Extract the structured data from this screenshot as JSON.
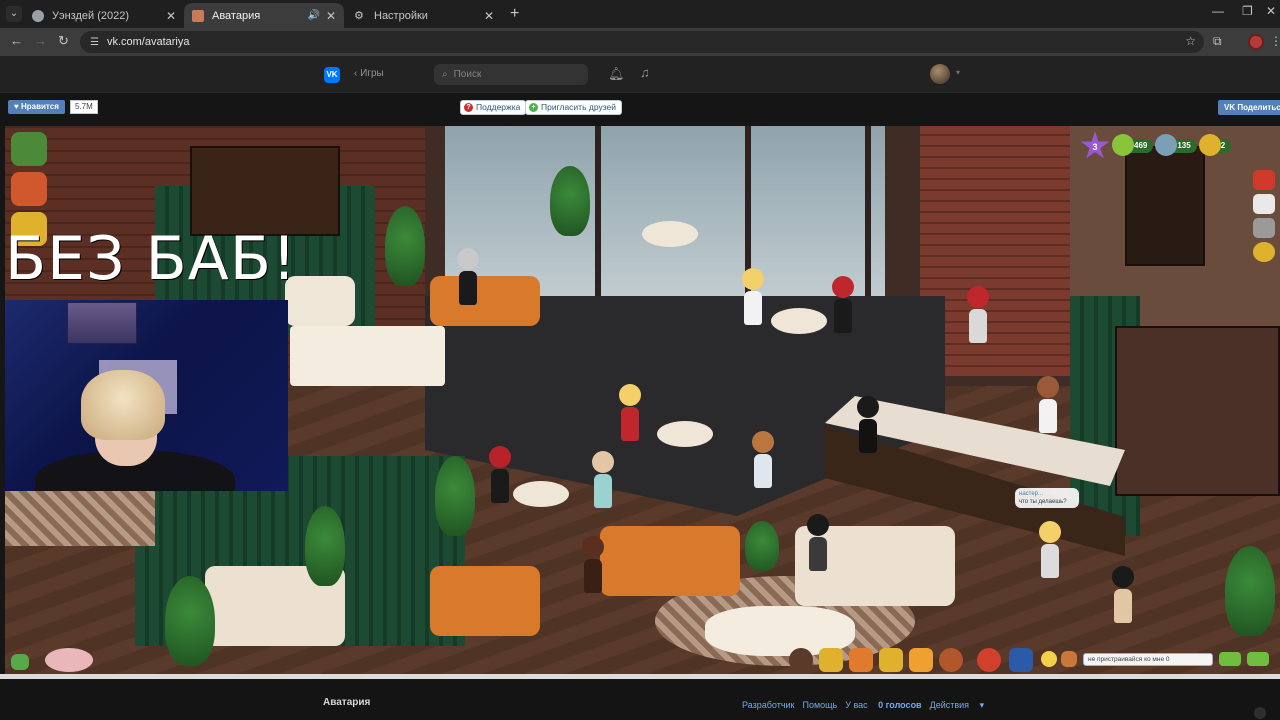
{
  "browser": {
    "tabs": [
      {
        "title": "Уэнздей (2022)",
        "active": false
      },
      {
        "title": "Аватария",
        "active": true
      },
      {
        "title": "Настройки",
        "active": false
      }
    ],
    "url": "vk.com/avatariya"
  },
  "vk_header": {
    "back_label": "Игры",
    "search_placeholder": "Поиск"
  },
  "app_bar": {
    "like_label": "Нравится",
    "like_count": "5.7M",
    "support_label": "Поддержка",
    "invite_label": "Пригласить друзей",
    "share_label": "Поделиться"
  },
  "game": {
    "overlay_text": "БЕЗ БАБ!",
    "level": "3",
    "stats": {
      "xp": "469",
      "silver": "135",
      "gold": "2"
    },
    "chat_bubble": {
      "name": "настер...",
      "text": "что ты делаешь?"
    },
    "chat_input_value": "не пристраивайся ко мне 0"
  },
  "footer": {
    "app_title": "Аватария",
    "links": {
      "developer": "Разработчик",
      "help": "Помощь",
      "votes_prefix": "У вас",
      "votes_value": "0 голосов",
      "actions": "Действия"
    }
  },
  "colors": {
    "vk_blue": "#0077ff",
    "vk_button": "#5181b8",
    "link": "#71aaeb"
  }
}
